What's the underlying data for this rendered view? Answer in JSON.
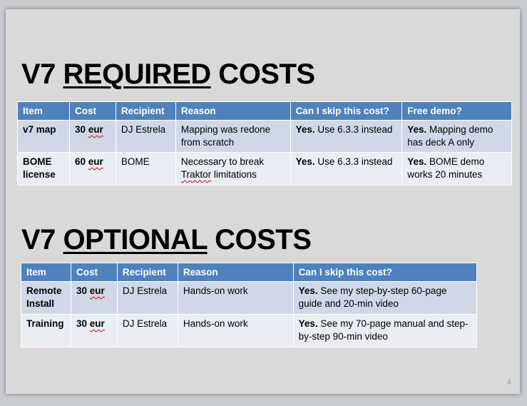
{
  "slide": {
    "page_number": "4"
  },
  "required": {
    "title_prefix": "V7 ",
    "title_emph": "REQUIRED",
    "title_suffix": " COSTS",
    "headers": [
      "Item",
      "Cost",
      "Recipient",
      "Reason",
      "Can I skip this cost?",
      "Free demo?"
    ],
    "rows": [
      {
        "item": "v7 map",
        "cost": "30",
        "unit": "eur",
        "recipient": "DJ Estrela",
        "reason": "Mapping was redone from scratch",
        "skip_yes": "Yes.",
        "skip": " Use 6.3.3 instead",
        "demo_yes": "Yes.",
        "demo": " Mapping demo has deck A only"
      },
      {
        "item": "BOME license",
        "cost": "60",
        "unit": "eur",
        "recipient": "BOME",
        "reason_a": "Necessary to break ",
        "reason_b": "Traktor",
        "reason_c": " limitations",
        "skip_yes": "Yes.",
        "skip": " Use 6.3.3 instead",
        "demo_yes": "Yes.",
        "demo": " BOME demo works 20 minutes"
      }
    ]
  },
  "optional": {
    "title_prefix": "V7 ",
    "title_emph": "OPTIONAL",
    "title_suffix": " COSTS",
    "headers": [
      "Item",
      "Cost",
      "Recipient",
      "Reason",
      "Can I skip this cost?"
    ],
    "rows": [
      {
        "item": "Remote Install",
        "cost": "30",
        "unit": "eur",
        "recipient": "DJ Estrela",
        "reason": "Hands-on work",
        "skip_yes": "Yes.",
        "skip": " See my step-by-step 60-page guide and 20-min video"
      },
      {
        "item": "Training",
        "cost": "30",
        "unit": "eur",
        "recipient": "DJ Estrela",
        "reason": "Hands-on work",
        "skip_yes": "Yes.",
        "skip": " See my 70-page manual and step-by-step 90-min video"
      }
    ]
  }
}
